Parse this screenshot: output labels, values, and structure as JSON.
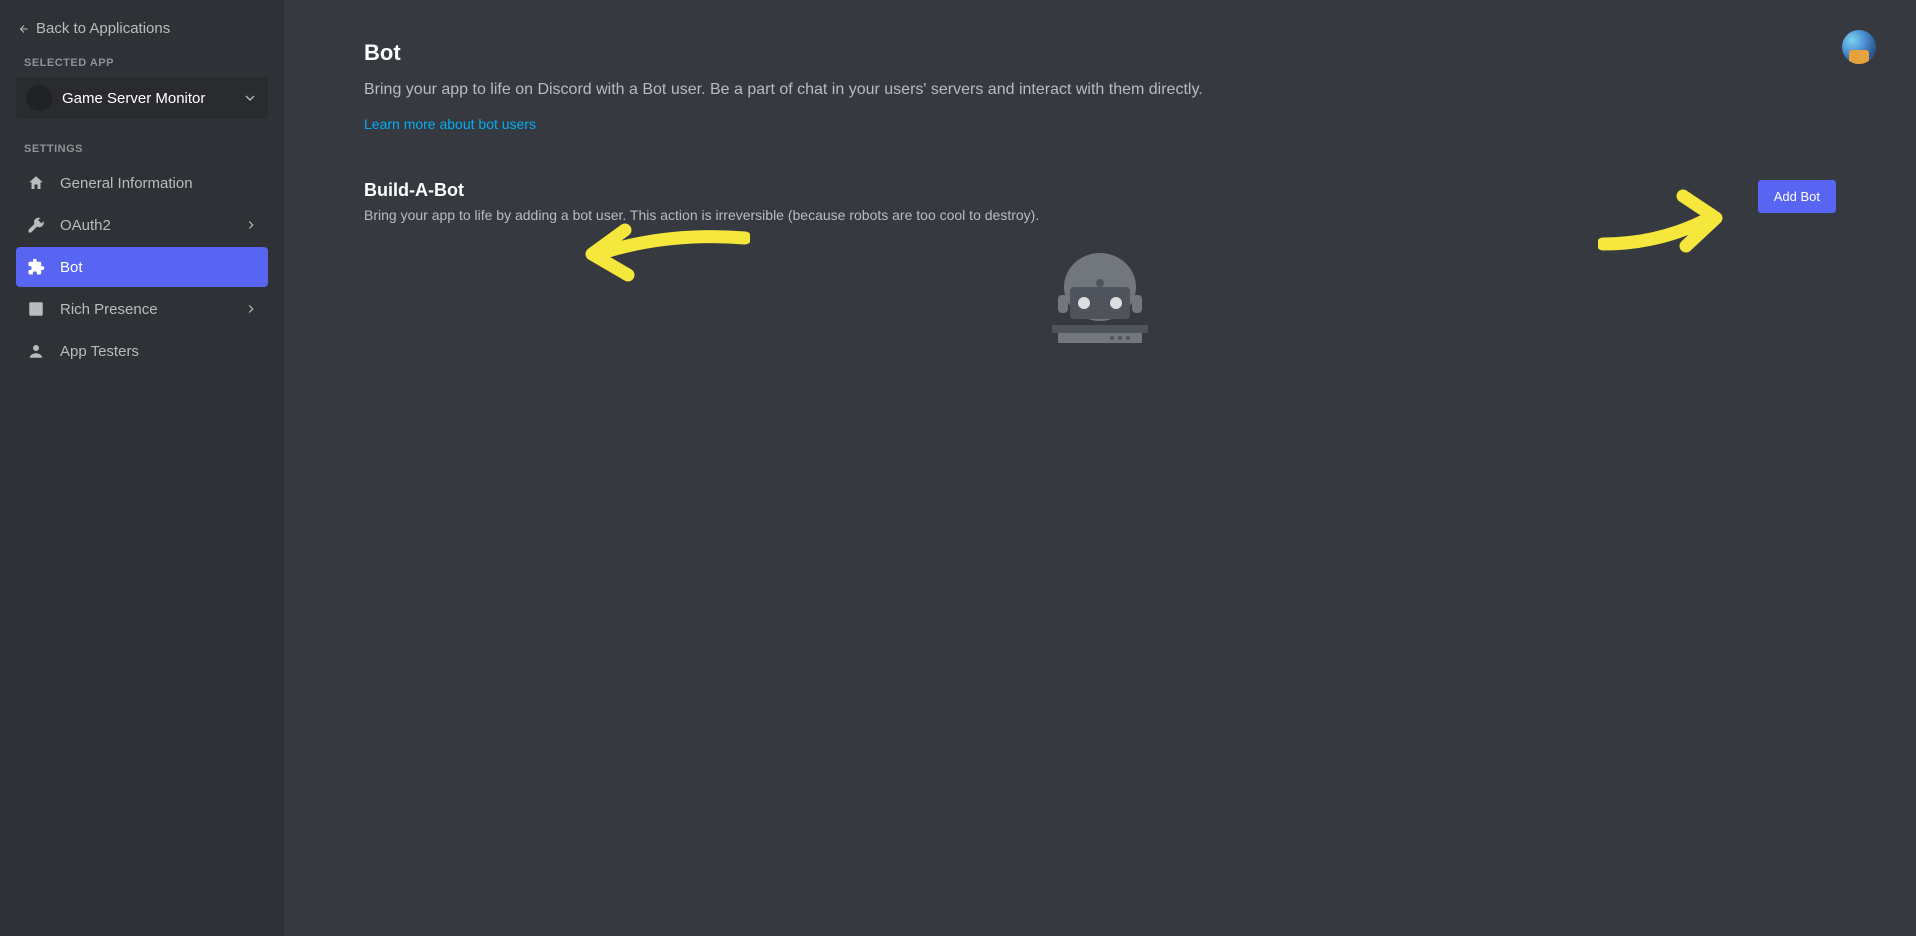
{
  "sidebar": {
    "back_label": "Back to Applications",
    "selected_label": "SELECTED APP",
    "app_name": "Game Server Monitor",
    "settings_label": "SETTINGS",
    "nav": [
      {
        "label": "General Information",
        "has_chevron": false
      },
      {
        "label": "OAuth2",
        "has_chevron": true
      },
      {
        "label": "Bot",
        "has_chevron": false
      },
      {
        "label": "Rich Presence",
        "has_chevron": true
      },
      {
        "label": "App Testers",
        "has_chevron": false
      }
    ]
  },
  "main": {
    "title": "Bot",
    "description": "Bring your app to life on Discord with a Bot user. Be a part of chat in your users' servers and interact with them directly.",
    "learn_link": "Learn more about bot users",
    "build_heading": "Build-A-Bot",
    "build_sub": "Bring your app to life by adding a bot user. This action is irreversible (because robots are too cool to destroy).",
    "add_bot_label": "Add Bot"
  }
}
